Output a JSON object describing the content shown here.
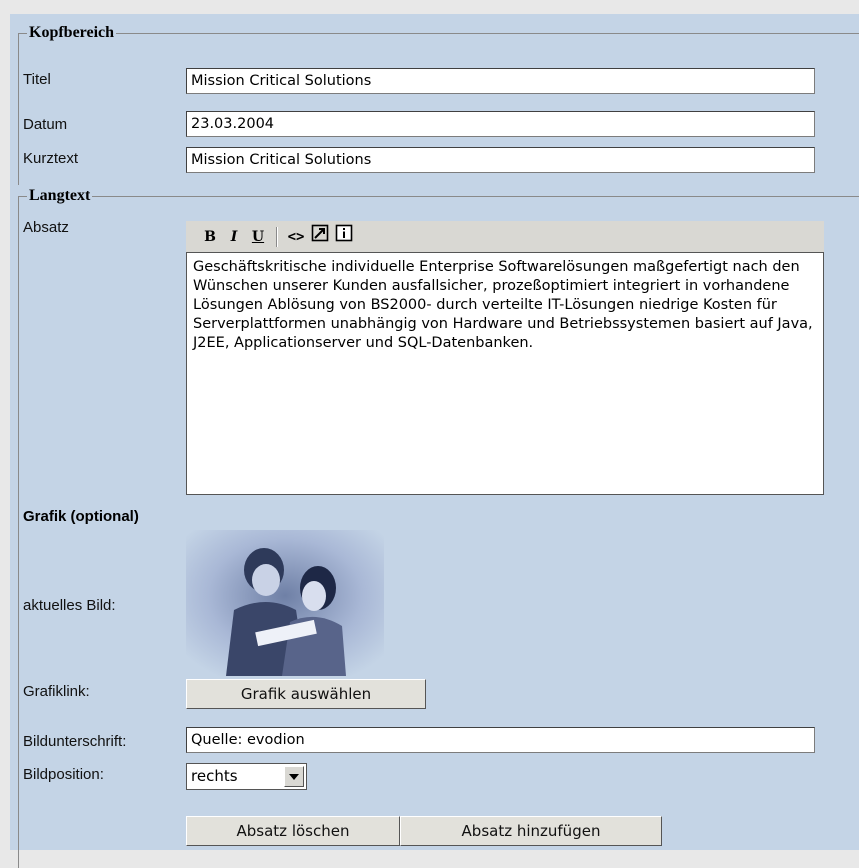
{
  "kopfbereich": {
    "legend": "Kopfbereich",
    "titel_label": "Titel",
    "titel_value": "Mission Critical Solutions",
    "datum_label": "Datum",
    "datum_value": "23.03.2004",
    "kurztext_label": "Kurztext",
    "kurztext_value": "Mission Critical Solutions"
  },
  "langtext": {
    "legend": "Langtext",
    "absatz_label": "Absatz",
    "toolbar": {
      "bold": "B",
      "italic": "I",
      "underline": "U",
      "source": "<>",
      "link_icon": "link-icon",
      "info": "i"
    },
    "absatz_text": "Geschäftskritische individuelle Enterprise Softwarelösungen maßgefertigt nach den Wünschen unserer Kunden ausfallsicher, prozeßoptimiert integriert in vorhandene Lösungen Ablösung von BS2000- durch verteilte IT-Lösungen niedrige Kosten für Serverplattformen unabhängig von Hardware und Betriebssystemen basiert auf Java, J2EE, Applicationserver und SQL-Datenbanken.",
    "grafik_heading": "Grafik (optional)",
    "aktuelles_bild_label": "aktuelles Bild:",
    "grafiklink_label": "Grafiklink:",
    "grafik_button": "Grafik auswählen",
    "bildunterschrift_label": "Bildunterschrift:",
    "bildunterschrift_value": "Quelle: evodion",
    "bildposition_label": "Bildposition:",
    "bildposition_value": "rechts",
    "delete_button": "Absatz löschen",
    "add_button": "Absatz hinzufügen"
  }
}
